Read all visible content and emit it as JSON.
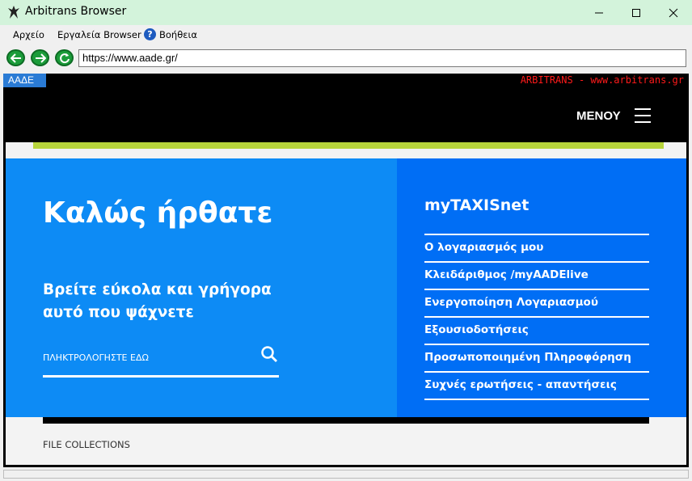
{
  "window": {
    "title": "Arbitrans Browser",
    "controls": {
      "minimize": "minimize-icon",
      "maximize": "maximize-icon",
      "close": "close-icon"
    }
  },
  "menubar": {
    "items": [
      "Αρχείο",
      "Εργαλεία Browser",
      "Βοήθεια"
    ],
    "help_icon": "?"
  },
  "navigation": {
    "back_icon": "back-arrow-icon",
    "forward_icon": "forward-arrow-icon",
    "refresh_icon": "refresh-icon",
    "url": "https://www.aade.gr/"
  },
  "tabs": {
    "active_label": "ΑΑΔΕ",
    "brand": "ARBITRANS - www.arbitrans.gr"
  },
  "page": {
    "menu_label": "ΜΕΝΟΥ",
    "welcome": "Καλώς ήρθατε",
    "subtitle": "Βρείτε εύκολα και γρήγορα αυτό που ψάχνετε",
    "search_placeholder": "ΠΛΗΚΤΡΟΛΟΓΗΣΤΕ ΕΔΩ",
    "taxisnet_title": "myTAXISnet",
    "taxisnet_links": [
      "Ο λογαριασμός μου",
      "Κλειδάριθμος /myAADElive",
      "Ενεργοποίηση Λογαριασμού",
      "Εξουσιοδοτήσεις",
      "Προσωποποιημένη Πληροφόρηση",
      "Συχνές ερωτήσεις - απαντήσεις"
    ],
    "file_collections": "FILE COLLECTIONS"
  },
  "colors": {
    "titlebar": "#d3f3db",
    "hero_left": "#0d8bf5",
    "hero_right": "#006ef5",
    "accent_green": "#b7d43b",
    "brand_red": "#ff1a1a"
  }
}
